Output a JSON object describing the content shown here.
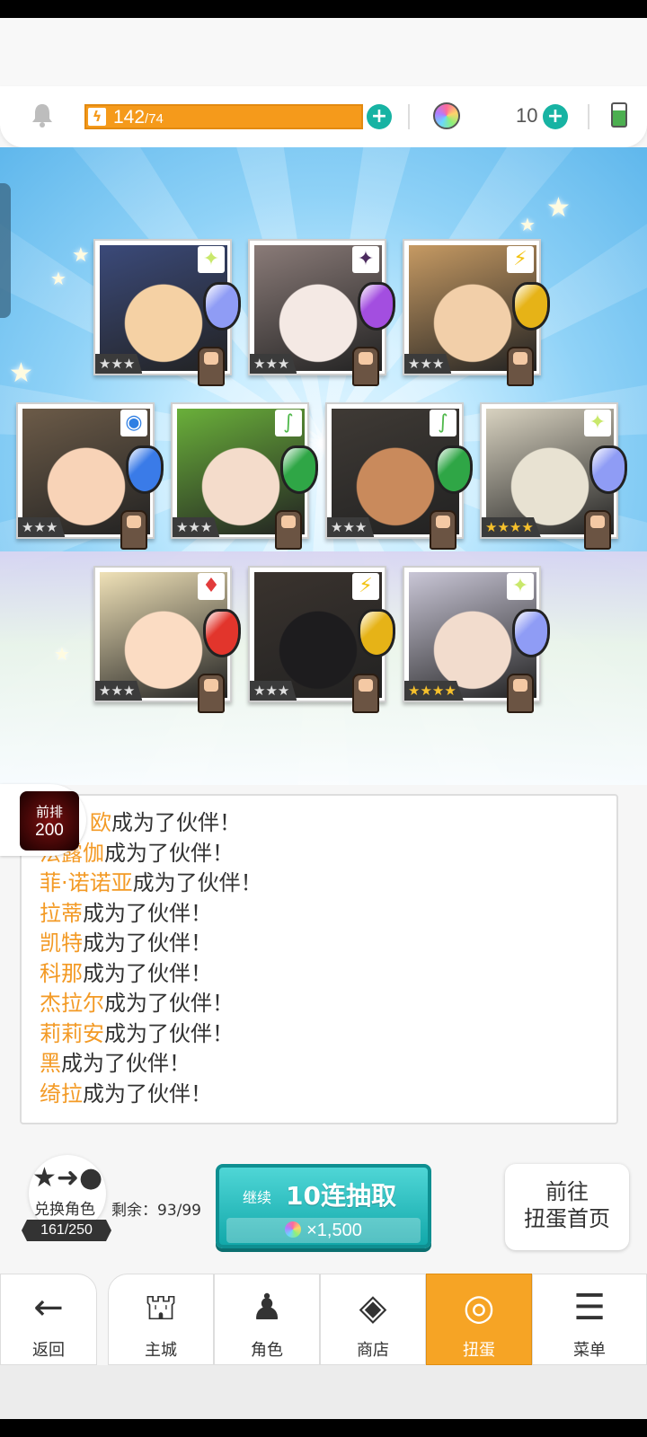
{
  "resources": {
    "energy_current": "142",
    "energy_max": "/74",
    "gem_count": "10"
  },
  "colors": {
    "energy": "#f59a1b",
    "accent_teal": "#17b3a3",
    "name_orange": "#f39a25",
    "active_tab": "#f6a425"
  },
  "cards": [
    {
      "stars": "★★★",
      "element": "light-icon",
      "element_glyph": "✦",
      "element_color": "#c9e86b",
      "crystal": "#8f9cf5",
      "bg": "#3b4a7a",
      "skin": "#f5d1a4"
    },
    {
      "stars": "★★★",
      "element": "dark-icon",
      "element_glyph": "✦",
      "element_color": "#4b2a5e",
      "crystal": "#a34ee0",
      "bg": "#8a7b78",
      "skin": "#f4e9e4"
    },
    {
      "stars": "★★★",
      "element": "thunder-icon",
      "element_glyph": "⚡",
      "element_color": "#f3c313",
      "crystal": "#e6b317",
      "bg": "#c69a63",
      "skin": "#f2cfa9"
    },
    {
      "stars": "★★★",
      "element": "water-icon",
      "element_glyph": "◉",
      "element_color": "#2f7fe3",
      "crystal": "#3a7be8",
      "bg": "#6c5b48",
      "skin": "#f8d3b7"
    },
    {
      "stars": "★★★",
      "element": "wind-icon",
      "element_glyph": "∫",
      "element_color": "#4fb84a",
      "crystal": "#2fa646",
      "bg": "#6ab03a",
      "skin": "#f4dccb"
    },
    {
      "stars": "★★★",
      "element": "wind-icon",
      "element_glyph": "∫",
      "element_color": "#4fb84a",
      "crystal": "#2fa646",
      "bg": "#3f3a35",
      "skin": "#c98a5c"
    },
    {
      "stars": "★★★★",
      "element": "light-icon",
      "element_glyph": "✦",
      "element_color": "#c9e86b",
      "crystal": "#8f9cf5",
      "bg": "#d8d2c0",
      "skin": "#e8e2d2"
    },
    {
      "stars": "★★★",
      "element": "fire-icon",
      "element_glyph": "♦",
      "element_color": "#e23b3b",
      "crystal": "#e2352c",
      "bg": "#efe1b7",
      "skin": "#fbdcc3"
    },
    {
      "stars": "★★★",
      "element": "thunder-icon",
      "element_glyph": "⚡",
      "element_color": "#f3c313",
      "crystal": "#e6b317",
      "bg": "#3a332e",
      "skin": "#1d1c1e"
    },
    {
      "stars": "★★★★",
      "element": "light-icon",
      "element_glyph": "✦",
      "element_color": "#c9e86b",
      "crystal": "#8f9cf5",
      "bg": "#c9c6d6",
      "skin": "#f2dccd"
    }
  ],
  "rank_badge": {
    "line1": "前排",
    "line2": "200"
  },
  "log": [
    {
      "name": "欧",
      "suffix": "成为了伙伴！"
    },
    {
      "name": "法露伽",
      "suffix": "成为了伙伴！"
    },
    {
      "name": "菲·诺诺亚",
      "suffix": "成为了伙伴！"
    },
    {
      "name": "拉蒂",
      "suffix": "成为了伙伴！"
    },
    {
      "name": "凯特",
      "suffix": "成为了伙伴！"
    },
    {
      "name": "科那",
      "suffix": "成为了伙伴！"
    },
    {
      "name": "杰拉尔",
      "suffix": "成为了伙伴！"
    },
    {
      "name": "莉莉安",
      "suffix": "成为了伙伴！"
    },
    {
      "name": "黑",
      "suffix": "成为了伙伴！"
    },
    {
      "name": "绮拉",
      "suffix": "成为了伙伴！"
    }
  ],
  "exchange": {
    "label": "兑换角色",
    "count": "161/250"
  },
  "remaining": "剩余：93/99",
  "pull_button": {
    "prefix": "继续",
    "label": "10连抽取",
    "cost": "×1,500"
  },
  "goto_button": {
    "line1": "前往",
    "line2": "扭蛋首页"
  },
  "nav": [
    {
      "label": "返回",
      "icon": "back-arrow-icon",
      "glyph": "←",
      "active": false
    },
    {
      "label": "主城",
      "icon": "castle-icon",
      "glyph": "⛫",
      "active": false
    },
    {
      "label": "角色",
      "icon": "character-icon",
      "glyph": "♟",
      "active": false
    },
    {
      "label": "商店",
      "icon": "shop-bag-icon",
      "glyph": "◈",
      "active": false
    },
    {
      "label": "扭蛋",
      "icon": "gacha-mirror-icon",
      "glyph": "◎",
      "active": true
    },
    {
      "label": "菜单",
      "icon": "menu-book-icon",
      "glyph": "☰",
      "active": false
    }
  ]
}
